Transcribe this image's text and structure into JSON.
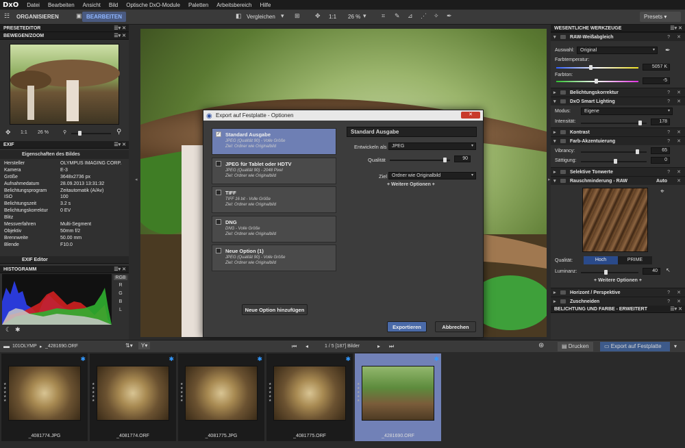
{
  "menubar": {
    "logo": "DxO",
    "items": [
      "Datei",
      "Bearbeiten",
      "Ansicht",
      "Bild",
      "Optische DxO-Module",
      "Paletten",
      "Arbeitsbereich",
      "Hilfe"
    ]
  },
  "toolbar": {
    "organise": "ORGANISIEREN",
    "edit": "BEARBEITEN",
    "compare": "Vergleichen",
    "zoom_ratio": "1:1",
    "zoom_percent": "26 %",
    "presets": "Presets"
  },
  "left_panel": {
    "preset_editor": "PRESETEDITOR",
    "move_zoom": "BEWEGEN/ZOOM",
    "nav_ratio": "1:1",
    "nav_percent": "26 %",
    "exif_title": "EXIF",
    "exif_subtitle": "Eigenschaften des Bildes",
    "exif_rows": [
      {
        "k": "Hersteller",
        "v": "OLYMPUS IMAGING CORP."
      },
      {
        "k": "Kamera",
        "v": "E-3"
      },
      {
        "k": "Größe",
        "v": "3648x2736 px"
      },
      {
        "k": "Aufnahmedatum",
        "v": "28.09.2013 13:31:32"
      },
      {
        "k": "Belichtungsprogram",
        "v": "Zeitautomatik (A/Av)"
      },
      {
        "k": "ISO",
        "v": "100"
      },
      {
        "k": "Belichtungszeit",
        "v": "3.2 s"
      },
      {
        "k": "Belichtungskorrektur",
        "v": "0 EV"
      },
      {
        "k": "Blitz",
        "v": ""
      },
      {
        "k": "Messverfahren",
        "v": "Multi-Segment"
      },
      {
        "k": "Objektiv",
        "v": "50mm f/2"
      },
      {
        "k": "Brennweite",
        "v": "50.00 mm"
      },
      {
        "k": "Blende",
        "v": "F10.0"
      }
    ],
    "exif_editor": "EXIF Editor",
    "histogram": "HISTOGRAMM",
    "hist_channels": [
      "RGB",
      "R",
      "G",
      "B",
      "L"
    ]
  },
  "right_panel": {
    "title": "WESENTLICHE WERKZEUGE",
    "raw_wb": "RAW-Weißabgleich",
    "auswahl_label": "Auswahl:",
    "auswahl_value": "Original",
    "farbtemp_label": "Farbtemperatur:",
    "farbtemp_value": "5057 K",
    "farbton_label": "Farbton:",
    "farbton_value": "-5",
    "belichtung": "Belichtungskorrektur",
    "smart_lighting": "DxO Smart Lighting",
    "modus_label": "Modus:",
    "modus_value": "Eigene",
    "intens_label": "Intensität:",
    "intens_value": "178",
    "kontrast": "Kontrast",
    "farb_akzent": "Farb-Akzentuierung",
    "vibrancy_label": "Vibrancy:",
    "vibrancy_value": "65",
    "saettigung_label": "Sättigung:",
    "saettigung_value": "0",
    "selektive": "Selektive Tonwerte",
    "rausch": "Rauschminderung - RAW",
    "rausch_auto": "Auto",
    "qualitaet_label": "Qualität:",
    "qualitaet_options": [
      "Hoch",
      "PRIME"
    ],
    "luminanz_label": "Luminanz:",
    "luminanz_value": "40",
    "weitere": "+ Weitere Optionen +",
    "horizont": "Horizont / Perspektive",
    "zuschneiden": "Zuschneiden",
    "bel_farbe": "BELICHTUNG UND FARBE - ERWEITERT"
  },
  "dialog": {
    "title": "Export auf Festplatte - Optionen",
    "options": [
      {
        "name": "Standard Ausgabe",
        "d1": "JPEG (Qualität 90)  -  Volle Größe",
        "d2": "Ziel: Ordner wie Originalbild",
        "selected": true
      },
      {
        "name": "JPEG für Tablet oder HDTV",
        "d1": "JPEG (Qualität 90)  -  2048 Pixel",
        "d2": "Ziel: Ordner wie Originalbild",
        "selected": false
      },
      {
        "name": "TIFF",
        "d1": "TIFF 16 bit  -  Volle Größe",
        "d2": "Ziel: Ordner wie Originalbild",
        "selected": false
      },
      {
        "name": "DNG",
        "d1": "DNG  -  Volle Größe",
        "d2": "Ziel: Ordner wie Originalbild",
        "selected": false
      },
      {
        "name": "Neue Option (1)",
        "d1": "JPEG (Qualität 90)  -  Volle Größe",
        "d2": "Ziel: Ordner wie Originalbild",
        "selected": false
      }
    ],
    "add_option": "Neue Option hinzufügen",
    "detail_title": "Standard Ausgabe",
    "entwickeln_label": "Entwickeln als",
    "entwickeln_value": "JPEG",
    "qualitaet_label": "Qualität",
    "qualitaet_value": "90",
    "ziel_label": "Ziel",
    "ziel_value": "Ordner wie Originalbild",
    "weitere": "+ Weitere Optionen +",
    "export_btn": "Exportieren",
    "cancel_btn": "Abbrechen"
  },
  "filmbar": {
    "folder": "101OLYMP",
    "file": "_4281690.ORF",
    "counter": "1 / 5 [187] Bilder",
    "print": "Drucken",
    "export": "Export auf Festplatte"
  },
  "thumbnails": [
    {
      "name": "_4081774.JPG",
      "selected": false,
      "mush": false
    },
    {
      "name": "_4081774.ORF",
      "selected": false,
      "mush": false
    },
    {
      "name": "_4081775.JPG",
      "selected": false,
      "mush": false
    },
    {
      "name": "_4081775.ORF",
      "selected": false,
      "mush": false
    },
    {
      "name": "_4281690.ORF",
      "selected": true,
      "mush": true
    }
  ]
}
